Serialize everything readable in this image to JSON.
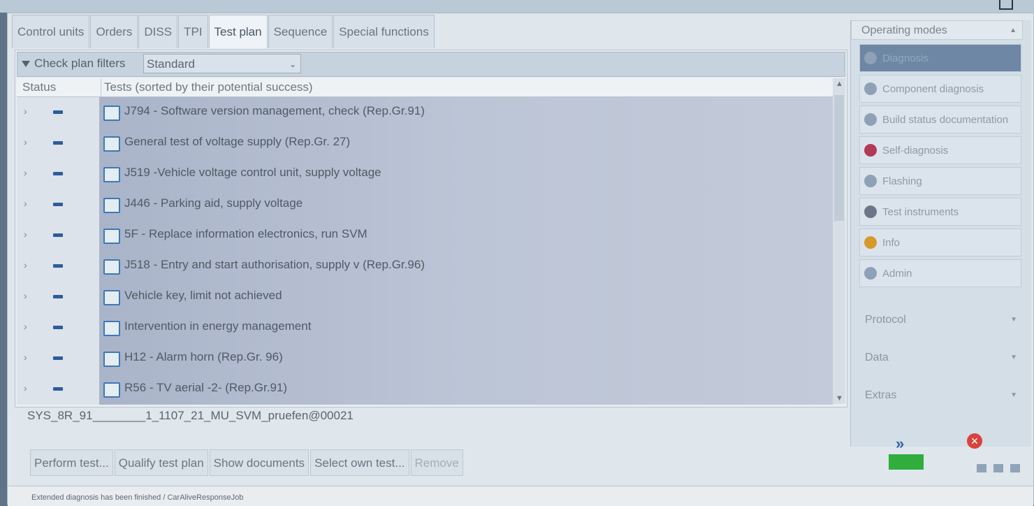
{
  "tabs": [
    "Control units",
    "Orders",
    "DISS",
    "TPI",
    "Test plan",
    "Sequence",
    "Special functions"
  ],
  "active_tab": "Test plan",
  "filter": {
    "label": "Check plan filters",
    "value": "Standard"
  },
  "columns": {
    "status": "Status",
    "tests": "Tests (sorted by their potential success)"
  },
  "tests": [
    "J794 - Software version management, check (Rep.Gr.91)",
    "General test of voltage supply (Rep.Gr. 27)",
    "J519 -Vehicle voltage control unit, supply voltage",
    "J446 - Parking aid, supply voltage",
    "5F - Replace information electronics, run SVM",
    "J518 - Entry and start authorisation, supply v (Rep.Gr.96)",
    "Vehicle key, limit not achieved",
    "Intervention in energy management",
    "H12 - Alarm horn (Rep.Gr. 96)",
    "R56 - TV aerial -2- (Rep.Gr.91)"
  ],
  "sys_line": "SYS_8R_91________1_1107_21_MU_SVM_pruefen@00021",
  "bottom_buttons": {
    "perform": "Perform test...",
    "qualify": "Qualify test plan",
    "show_docs": "Show documents",
    "select_own": "Select own test...",
    "remove": "Remove"
  },
  "status_text": "Extended diagnosis has been finished / CarAliveResponseJob",
  "right_panel": {
    "operating_modes": "Operating modes",
    "items": [
      "Diagnosis",
      "Component diagnosis",
      "Build status documentation",
      "Self-diagnosis",
      "Flashing",
      "Test instruments",
      "Info",
      "Admin"
    ],
    "protocol": "Protocol",
    "data": "Data",
    "extras": "Extras"
  },
  "colors": {
    "accent": "#2f66a8",
    "active_mode": "#6d87a4",
    "ok_indicator": "#2fae3e",
    "close": "#d8433d"
  }
}
